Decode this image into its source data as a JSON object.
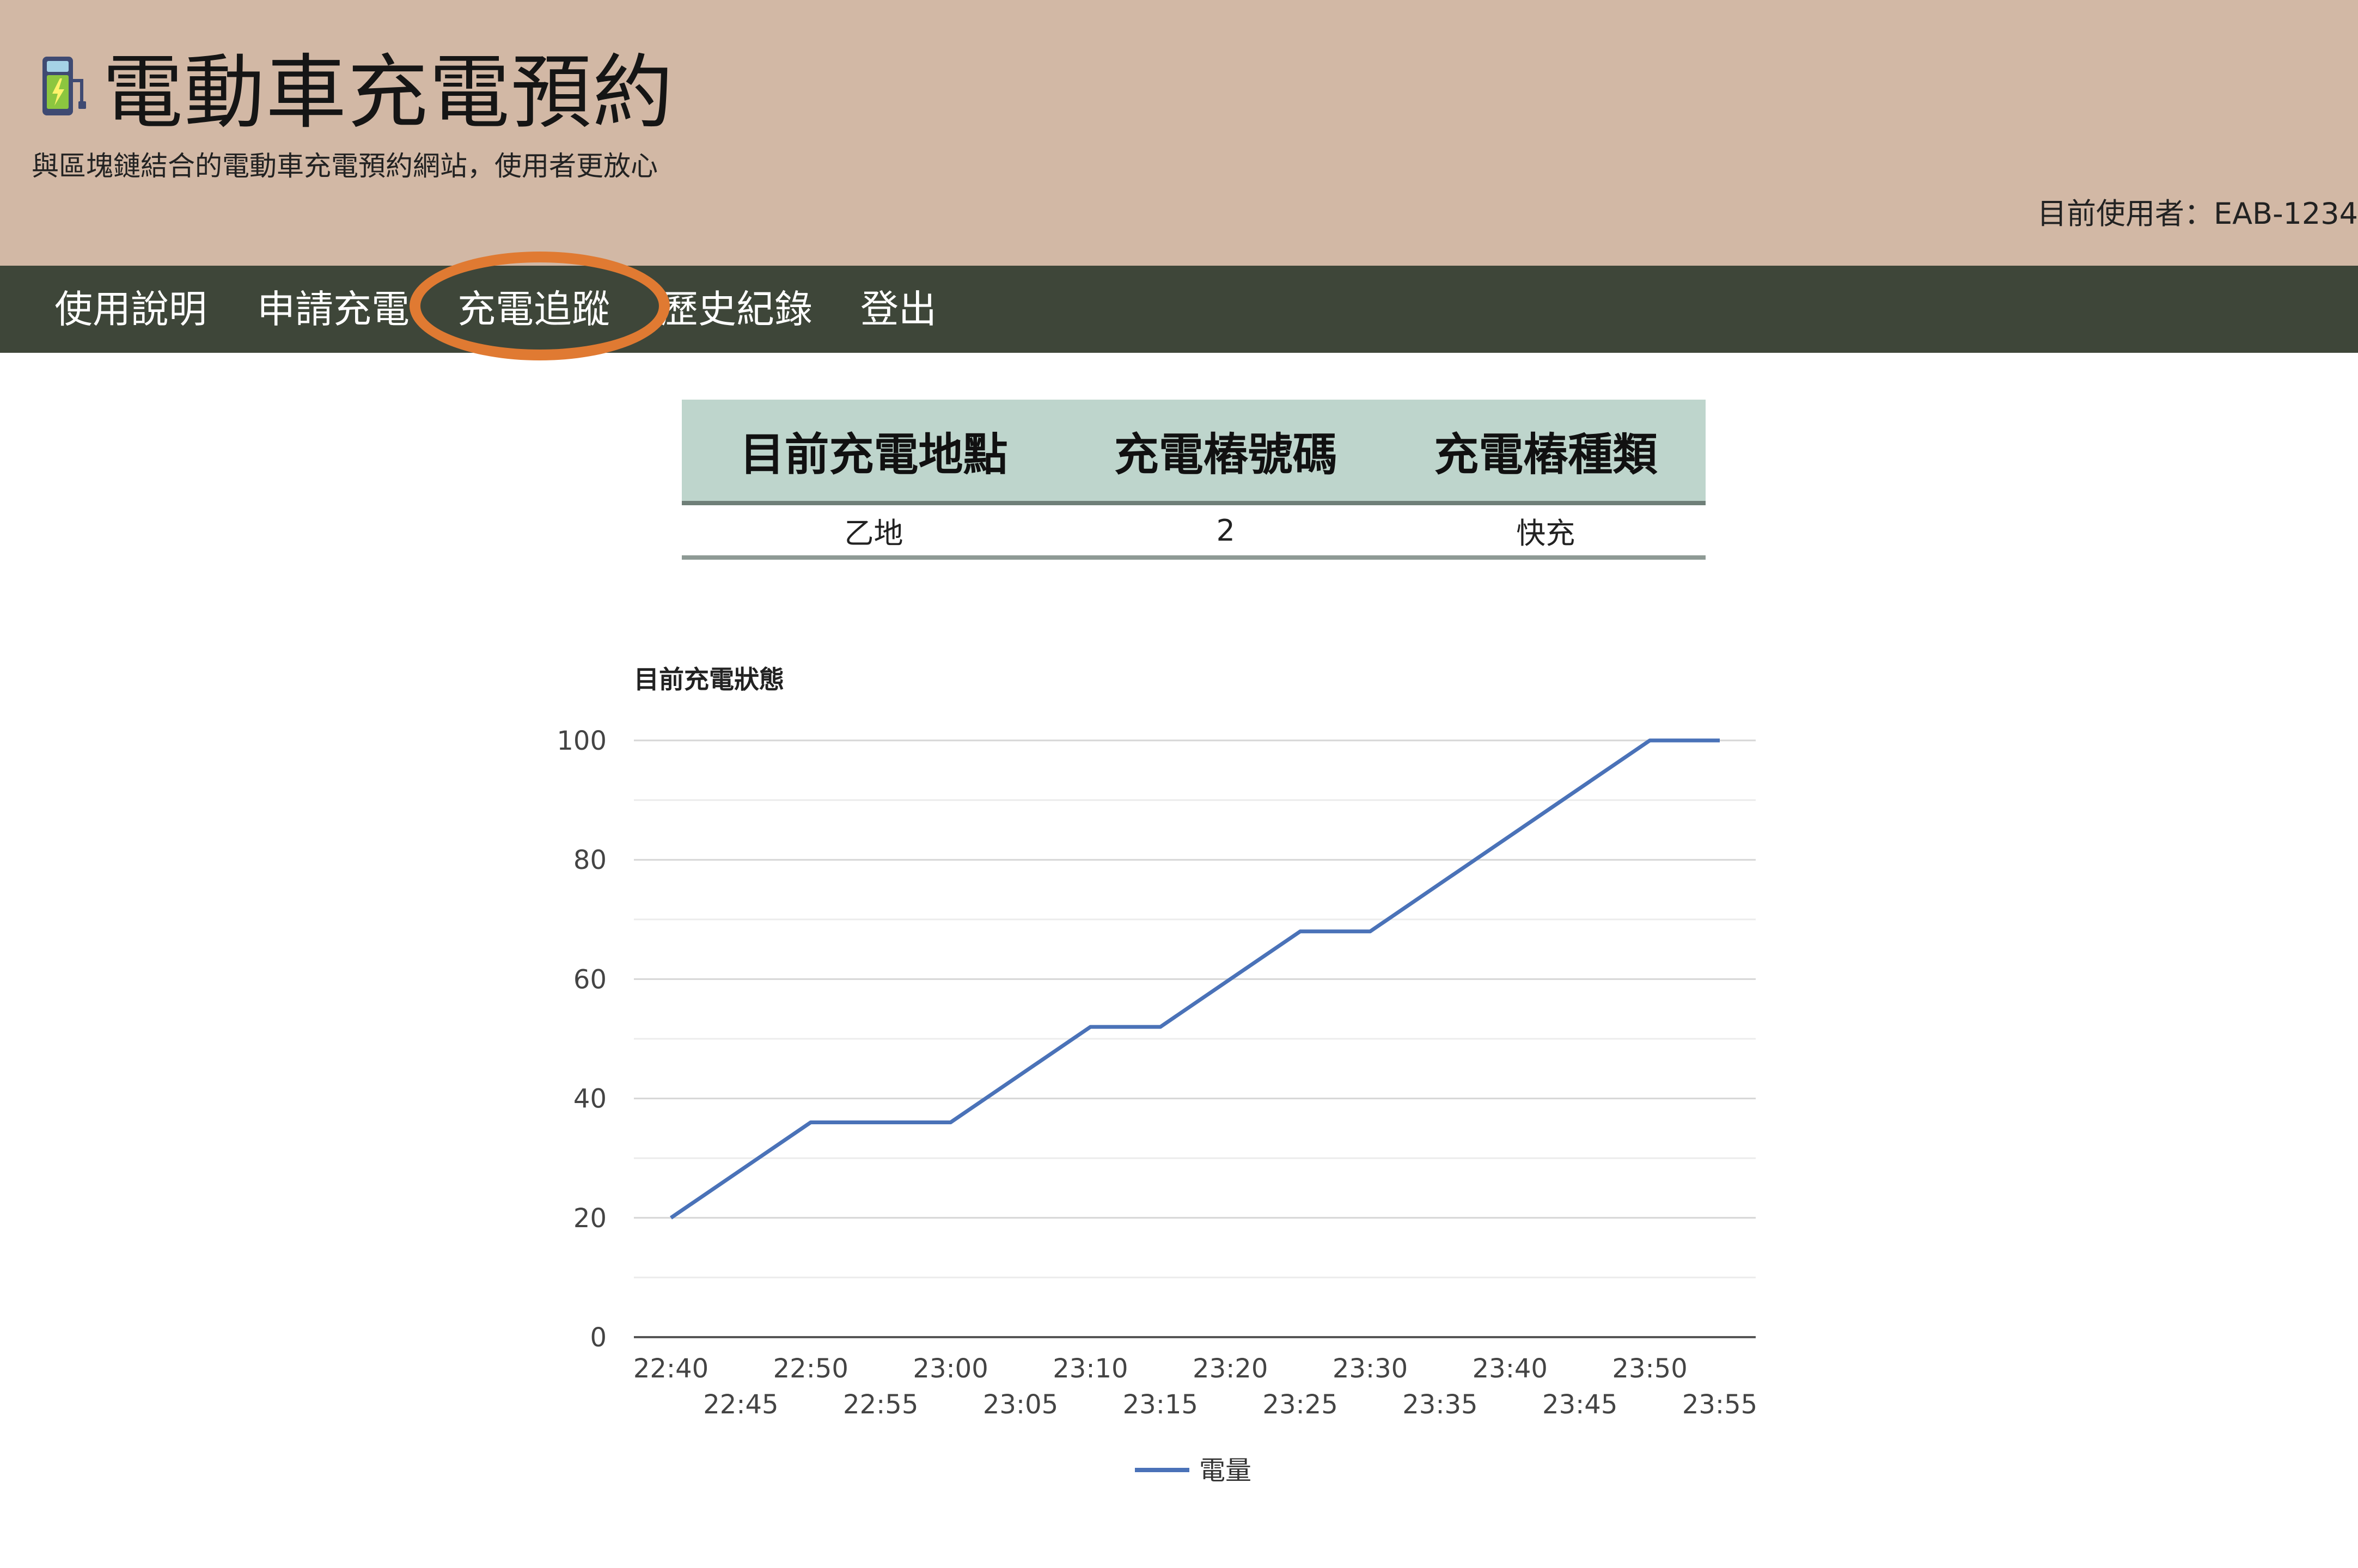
{
  "header": {
    "title": "電動車充電預約",
    "subtitle": "與區塊鏈結合的電動車充電預約網站，使用者更放心",
    "current_user": "目前使用者：EAB-1234",
    "logo_icon": "ev-charger-icon"
  },
  "nav": {
    "items": [
      {
        "label": "使用說明"
      },
      {
        "label": "申請充電"
      },
      {
        "label": "充電追蹤"
      },
      {
        "label": "歷史紀錄"
      },
      {
        "label": "登出"
      }
    ],
    "active_index": 2,
    "highlight_color": "#e07a32"
  },
  "info_table": {
    "headers": [
      "目前充電地點",
      "充電樁號碼",
      "充電樁種類"
    ],
    "row": [
      "乙地",
      "2",
      "快充"
    ]
  },
  "chart_data": {
    "type": "line",
    "title": "目前充電狀態",
    "xlabel": "",
    "ylabel": "",
    "x": [
      "22:40",
      "22:45",
      "22:50",
      "22:55",
      "23:00",
      "23:05",
      "23:10",
      "23:15",
      "23:20",
      "23:25",
      "23:30",
      "23:35",
      "23:40",
      "23:45",
      "23:50",
      "23:55"
    ],
    "series": [
      {
        "name": "電量",
        "values": [
          20,
          28,
          36,
          36,
          36,
          44,
          52,
          52,
          60,
          68,
          68,
          76,
          84,
          92,
          100,
          100
        ],
        "color": "#4a72b8"
      }
    ],
    "ylim": [
      0,
      100
    ],
    "yticks": [
      0,
      20,
      40,
      60,
      80,
      100
    ],
    "grid": true,
    "legend": "bottom"
  }
}
